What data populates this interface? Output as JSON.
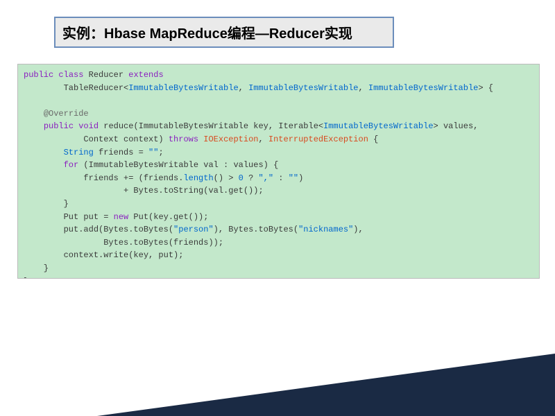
{
  "title": "实例：Hbase MapReduce编程—Reducer实现",
  "code": {
    "l1a": "public",
    "l1b": "class",
    "l1c": " Reducer ",
    "l1d": "extends",
    "l2a": "        TableReducer<",
    "l2b": "ImmutableBytesWritable",
    "l2c": ", ",
    "l2d": "ImmutableBytesWritable",
    "l2e": ", ",
    "l2f": "ImmutableBytesWritable",
    "l2g": "> {",
    "l3": "",
    "l4a": "    ",
    "l4b": "@Override",
    "l5a": "    ",
    "l5b": "public",
    "l5c": " ",
    "l5d": "void",
    "l5e": " reduce(ImmutableBytesWritable key, Iterable<",
    "l5f": "ImmutableBytesWritable",
    "l5g": "> values,",
    "l6a": "            Context context) ",
    "l6b": "throws",
    "l6c": " ",
    "l6d": "IOException",
    "l6e": ", ",
    "l6f": "InterruptedException",
    "l6g": " {",
    "l7a": "        ",
    "l7b": "String",
    "l7c": " friends = ",
    "l7d": "\"\"",
    "l7e": ";",
    "l8a": "        ",
    "l8b": "for",
    "l8c": " (ImmutableBytesWritable val : values) {",
    "l9a": "            friends += (friends.",
    "l9b": "length",
    "l9c": "() > ",
    "l9d": "0",
    "l9e": " ? ",
    "l9f": "\",\"",
    "l9g": " : ",
    "l9h": "\"\"",
    "l9i": ")",
    "l10a": "                    + Bytes.toString(val.get());",
    "l11": "        }",
    "l12a": "        Put put = ",
    "l12b": "new",
    "l12c": " Put(key.get());",
    "l13a": "        put.add(Bytes.toBytes(",
    "l13b": "\"person\"",
    "l13c": "), Bytes.toBytes(",
    "l13d": "\"nicknames\"",
    "l13e": "),",
    "l14a": "                Bytes.toBytes(friends));",
    "l15": "        context.write(key, put);",
    "l16": "    }",
    "l17": "}"
  }
}
